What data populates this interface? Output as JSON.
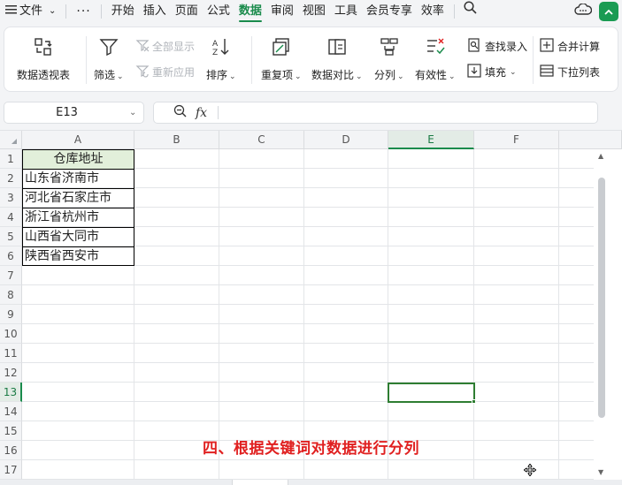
{
  "menu": {
    "file": "文件",
    "more": "···",
    "tabs": [
      "开始",
      "插入",
      "页面",
      "公式",
      "数据",
      "审阅",
      "视图",
      "工具",
      "会员专享",
      "效率"
    ],
    "active_tab": "数据"
  },
  "ribbon": {
    "pivot": "数据透视表",
    "filter": "筛选",
    "show_all": "全部显示",
    "reapply": "重新应用",
    "sort": "排序",
    "duplicates": "重复项",
    "compare": "数据对比",
    "split": "分列",
    "validity": "有效性",
    "find_entry": "查找录入",
    "fill": "填充",
    "consolidate": "合并计算",
    "dropdown_list": "下拉列表"
  },
  "formula_bar": {
    "name_box": "E13",
    "fx": "fx",
    "formula": ""
  },
  "sheet": {
    "columns": [
      "A",
      "B",
      "C",
      "D",
      "E",
      "F"
    ],
    "selected_column": "E",
    "rows": [
      "1",
      "2",
      "3",
      "4",
      "5",
      "6",
      "7",
      "8",
      "9",
      "10",
      "11",
      "12",
      "13",
      "14",
      "15",
      "16",
      "17"
    ],
    "selected_row": "13",
    "table_header": "仓库地址",
    "table_values": [
      "山东省济南市",
      "河北省石家庄市",
      "浙江省杭州市",
      "山西省大同市",
      "陕西省西安市"
    ]
  },
  "caption": "四、根据关键词对数据进行分列",
  "colors": {
    "accent": "#1a8b4c",
    "header_fill": "#e2efda",
    "caption": "#e02020"
  }
}
